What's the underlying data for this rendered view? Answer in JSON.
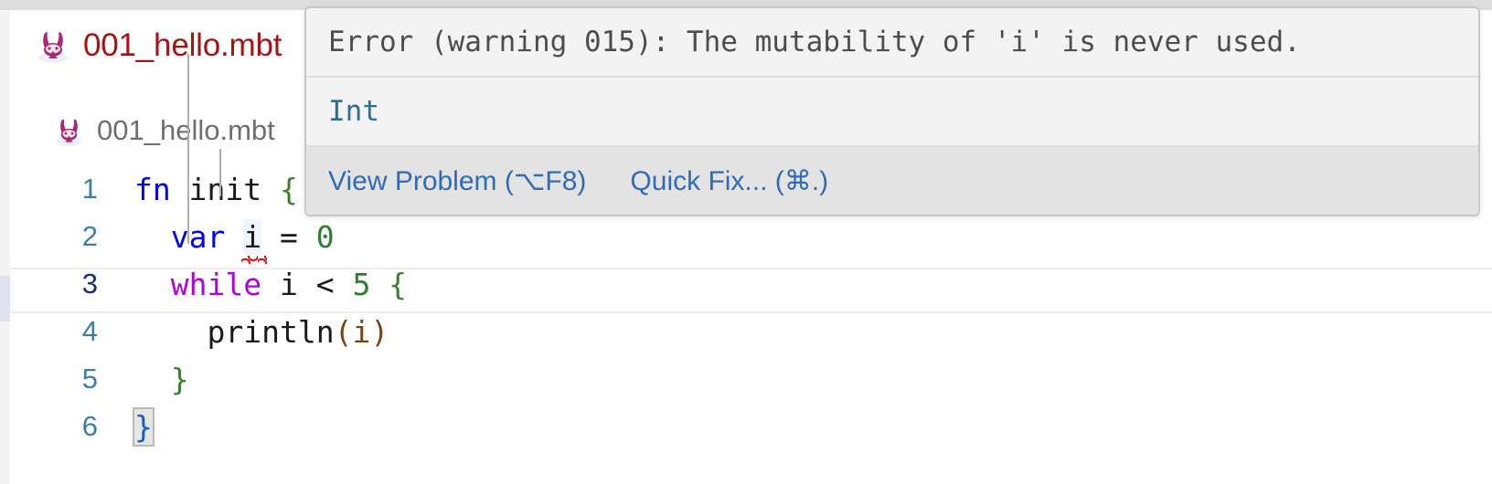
{
  "window": {
    "accent_error": "#a31515",
    "accent_link": "#2f6cb5",
    "editor_bg": "#ffffff"
  },
  "tab": {
    "icon": "moonbit-rabbit-icon",
    "label": "001_hello.mbt"
  },
  "breadcrumb": {
    "icon": "moonbit-rabbit-icon",
    "label": "001_hello.mbt"
  },
  "editor": {
    "lines": [
      {
        "number": "1",
        "active": false,
        "tokens": [
          {
            "text": "fn ",
            "kind": "keyword"
          },
          {
            "text": "init",
            "kind": "plain"
          },
          {
            "text": " {",
            "kind": "brace"
          }
        ]
      },
      {
        "number": "2",
        "active": false,
        "tokens": [
          {
            "text": "  ",
            "kind": "plain"
          },
          {
            "text": "var ",
            "kind": "keyword"
          },
          {
            "text": "i",
            "kind": "error-underline"
          },
          {
            "text": " = ",
            "kind": "plain"
          },
          {
            "text": "0",
            "kind": "number"
          }
        ]
      },
      {
        "number": "3",
        "active": true,
        "tokens": [
          {
            "text": "  ",
            "kind": "plain"
          },
          {
            "text": "while",
            "kind": "control-keyword"
          },
          {
            "text": " i < ",
            "kind": "plain"
          },
          {
            "text": "5",
            "kind": "number"
          },
          {
            "text": " {",
            "kind": "brace"
          }
        ]
      },
      {
        "number": "4",
        "active": false,
        "tokens": [
          {
            "text": "    ",
            "kind": "plain"
          },
          {
            "text": "println",
            "kind": "plain"
          },
          {
            "text": "(",
            "kind": "fnarg"
          },
          {
            "text": "i",
            "kind": "fnarg"
          },
          {
            "text": ")",
            "kind": "fnarg"
          }
        ]
      },
      {
        "number": "5",
        "active": false,
        "tokens": [
          {
            "text": "  ",
            "kind": "plain"
          },
          {
            "text": "}",
            "kind": "brace"
          }
        ]
      },
      {
        "number": "6",
        "active": false,
        "tokens": [
          {
            "text": "}",
            "kind": "bracket-match"
          }
        ]
      }
    ]
  },
  "hover": {
    "message": "Error (warning 015): The mutability of 'i' is never used.",
    "type_signature": "Int",
    "actions": [
      {
        "label": "View Problem (⌥F8)"
      },
      {
        "label": "Quick Fix... (⌘.)"
      }
    ]
  }
}
